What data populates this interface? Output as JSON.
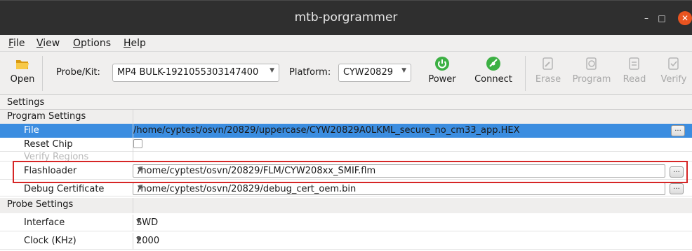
{
  "window": {
    "title": "mtb-porgrammer",
    "minimize_glyph": "–",
    "maximize_glyph": "□",
    "close_glyph": "✕"
  },
  "menubar": {
    "items": [
      {
        "prefix": "",
        "hotkey": "F",
        "rest": "ile"
      },
      {
        "prefix": "",
        "hotkey": "V",
        "rest": "iew"
      },
      {
        "prefix": "",
        "hotkey": "O",
        "rest": "ptions"
      },
      {
        "prefix": "",
        "hotkey": "H",
        "rest": "elp"
      }
    ]
  },
  "toolbar": {
    "open_label": "Open",
    "probe_label": "Probe/Kit:",
    "probe_value": "MP4 BULK-1921055303147400",
    "platform_label": "Platform:",
    "platform_value": "CYW20829",
    "power_label": "Power",
    "connect_label": "Connect",
    "erase_label": "Erase",
    "program_label": "Program",
    "read_label": "Read",
    "verify_label": "Verify",
    "dropdown_arrow": "▼"
  },
  "settings": {
    "header": "Settings",
    "program_settings": {
      "label": "Program Settings",
      "rows": {
        "file": {
          "label": "File",
          "value": "/home/cyptest/osvn/20829/uppercase/CYW20829A0LKML_secure_no_cm33_app.HEX"
        },
        "reset_chip": {
          "label": "Reset Chip",
          "checked": false
        },
        "verify_regions": {
          "label": "Verify Regions"
        },
        "flashloader": {
          "label": "Flashloader",
          "value": "/home/cyptest/osvn/20829/FLM/CYW208xx_SMIF.flm"
        },
        "debug_certificate": {
          "label": "Debug Certificate",
          "value": "/home/cyptest/osvn/20829/debug_cert_oem.bin"
        }
      }
    },
    "probe_settings": {
      "label": "Probe Settings",
      "rows": {
        "interface": {
          "label": "Interface",
          "value": "SWD"
        },
        "clock": {
          "label": "Clock (KHz)",
          "value": "2000"
        }
      }
    },
    "browse_label": "...",
    "dropdown_arrow": "▼"
  },
  "colors": {
    "selection": "#3b8de0",
    "highlight_border": "#d62626",
    "titlebar": "#2f2f2f",
    "close_button": "#e95420",
    "power_icon": "#3cb043",
    "connect_icon": "#3cb043",
    "open_icon": "#f0b429"
  }
}
